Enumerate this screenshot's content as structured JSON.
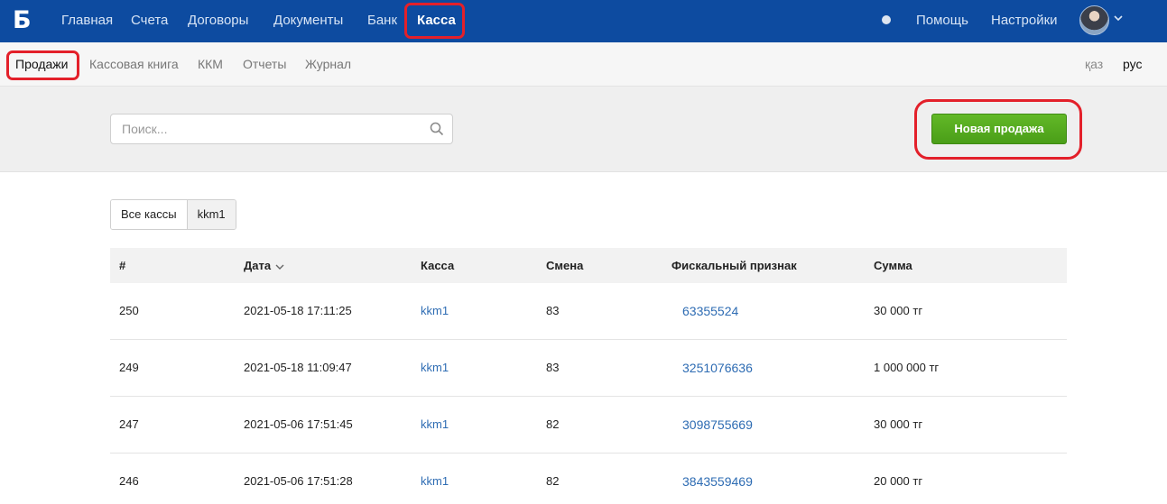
{
  "app": {
    "logo": "Б"
  },
  "nav": {
    "items": [
      "Главная",
      "Счета",
      "Договоры",
      "Документы",
      "Банк",
      "Касса"
    ],
    "active": "Касса",
    "help": "Помощь",
    "settings": "Настройки"
  },
  "subnav": {
    "items": [
      "Продажи",
      "Кассовая книга",
      "ККМ",
      "Отчеты",
      "Журнал"
    ],
    "active": "Продажи",
    "lang_kz": "қаз",
    "lang_ru": "рус"
  },
  "search": {
    "placeholder": "Поиск...",
    "value": ""
  },
  "new_sale_button": "Новая продажа",
  "filter": {
    "all": "Все кассы",
    "selected": "kkm1"
  },
  "table": {
    "columns": [
      "#",
      "Дата",
      "Касса",
      "Смена",
      "Фискальный признак",
      "Сумма"
    ],
    "rows": [
      [
        "250",
        "2021-05-18 17:11:25",
        "kkm1",
        "83",
        "63355524",
        "30 000 тг"
      ],
      [
        "249",
        "2021-05-18 11:09:47",
        "kkm1",
        "83",
        "3251076636",
        "1 000 000 тг"
      ],
      [
        "247",
        "2021-05-06 17:51:45",
        "kkm1",
        "82",
        "3098755669",
        "30 000 тг"
      ],
      [
        "246",
        "2021-05-06 17:51:28",
        "kkm1",
        "82",
        "3843559469",
        "20 000 тг"
      ]
    ]
  },
  "colors": {
    "nav_bg": "#0d4ba0",
    "highlight": "#e3202a",
    "button_green": "#52a81d",
    "link": "#2e6cb3"
  }
}
